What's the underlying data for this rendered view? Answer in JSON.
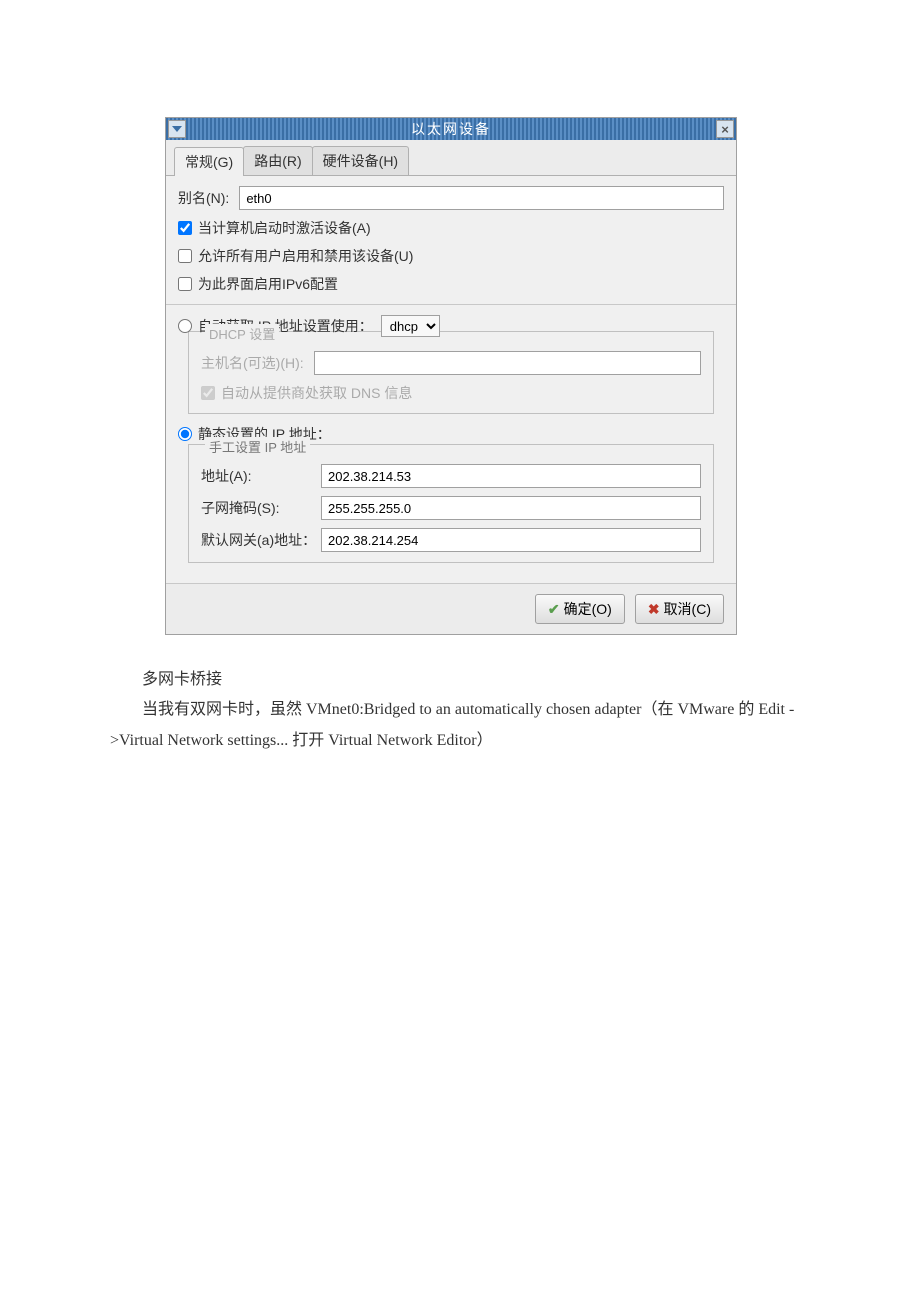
{
  "window": {
    "title": "以太网设备"
  },
  "tabs": {
    "general": "常规(G)",
    "route": "路由(R)",
    "hardware": "硬件设备(H)"
  },
  "alias": {
    "label": "别名(N):",
    "value": "eth0"
  },
  "checkboxes": {
    "activate_on_boot": "当计算机启动时激活设备(A)",
    "allow_all_users": "允许所有用户启用和禁用该设备(U)",
    "enable_ipv6": "为此界面启用IPv6配置"
  },
  "ip_mode": {
    "dhcp_label": "自动获取 IP 地址设置使用：",
    "dhcp_option": "dhcp",
    "dhcp_section_title": "DHCP 设置",
    "hostname_label": "主机名(可选)(H):",
    "auto_dns_label": "自动从提供商处获取 DNS 信息",
    "static_label": "静态设置的 IP 地址：",
    "manual_section_title": "手工设置 IP 地址"
  },
  "static": {
    "address_label": "地址(A):",
    "address_value": "202.38.214.53",
    "subnet_label": "子网掩码(S):",
    "subnet_value": "255.255.255.0",
    "gateway_label": "默认网关(a)地址：",
    "gateway_value": "202.38.214.254"
  },
  "buttons": {
    "ok": "确定(O)",
    "cancel": "取消(C)"
  },
  "body_text": {
    "p1": "多网卡桥接",
    "p2": "当我有双网卡时，虽然 VMnet0:Bridged to an automatically chosen adapter（在 VMware 的 Edit ->Virtual Network settings... 打开 Virtual Network Editor）"
  }
}
